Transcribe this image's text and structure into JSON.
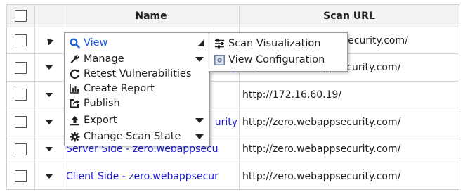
{
  "table": {
    "headers": {
      "name": "Name",
      "url": "Scan URL"
    },
    "rows": [
      {
        "name": "",
        "url": "psecurity.com/"
      },
      {
        "name": "",
        "url": "http://zero.webappsecurity.com/"
      },
      {
        "name": "",
        "url": "http://172.16.60.19/"
      },
      {
        "name": "",
        "url": "http://zero.webappsecurity.com/"
      },
      {
        "name": "Server Side - zero.webappsecu",
        "url": "http://zero.webappsecurity.com/"
      },
      {
        "name": "Client Side - zero.webappsecur",
        "url": "http://zero.webappsecurity.com/"
      }
    ],
    "partial_names": {
      "row2": "urity",
      "row4": "urity"
    }
  },
  "context_menu": {
    "items": [
      {
        "label": "View",
        "icon": "search-icon"
      },
      {
        "label": "Manage",
        "icon": "wrench-icon"
      },
      {
        "label": "Retest Vulnerabilities",
        "icon": "refresh-icon"
      },
      {
        "label": "Create Report",
        "icon": "chart-icon"
      },
      {
        "label": "Publish",
        "icon": "publish-icon"
      },
      {
        "label": "Export",
        "icon": "export-icon"
      },
      {
        "label": "Change Scan State",
        "icon": "gear-icon"
      }
    ]
  },
  "submenu": {
    "items": [
      {
        "label": "Scan Visualization",
        "icon": "sliders-icon"
      },
      {
        "label": "View Configuration",
        "icon": "config-icon"
      }
    ]
  },
  "colors": {
    "link": "#1a1ad6",
    "highlight": "#1a5fd6"
  }
}
